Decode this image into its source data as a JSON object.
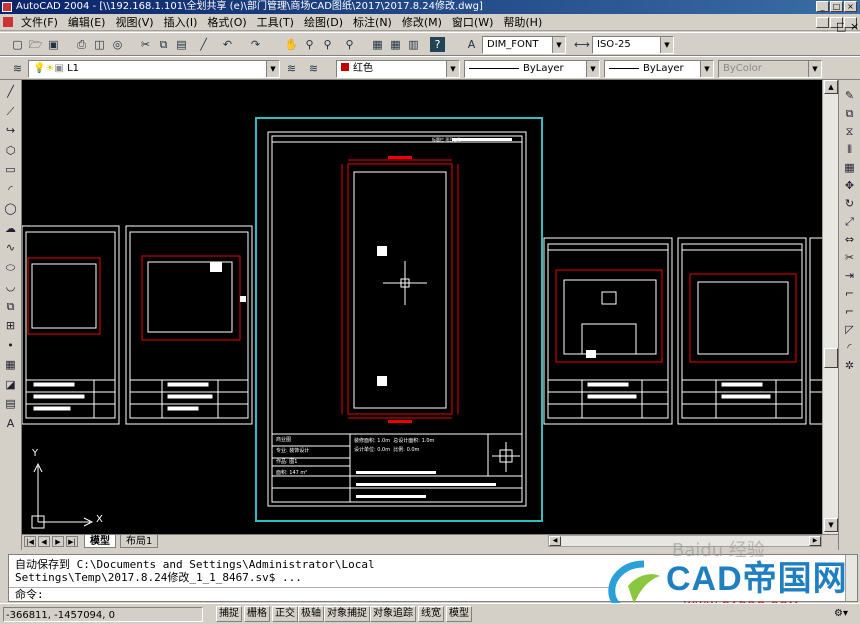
{
  "titlebar": {
    "title": "AutoCAD 2004 - [\\\\192.168.1.101\\全划共享 (e)\\部门管理\\商场CAD图纸\\2017\\2017.8.24修改.dwg]",
    "controls": [
      "_",
      "□",
      "×"
    ]
  },
  "doc_controls": [
    "_",
    "□",
    "×"
  ],
  "menu": [
    "文件(F)",
    "编辑(E)",
    "视图(V)",
    "插入(I)",
    "格式(O)",
    "工具(T)",
    "绘图(D)",
    "标注(N)",
    "修改(M)",
    "窗口(W)",
    "帮助(H)"
  ],
  "standard_toolbar": {
    "icons": [
      "new-icon",
      "open-icon",
      "save-icon",
      "print-icon",
      "preview-icon",
      "publish-icon",
      "cut-icon",
      "copy-icon",
      "paste-icon",
      "matchprop-icon",
      "undo-icon",
      "redo-icon",
      "pan-icon",
      "zoom-realtime-icon",
      "zoom-window-icon",
      "zoom-previous-icon",
      "properties-icon",
      "designcenter-icon",
      "toolpalette-icon",
      "help-icon"
    ],
    "text_style": "DIM_FONT",
    "dim_style": "ISO-25"
  },
  "layers_toolbar": {
    "layer_name": "L1",
    "color": "红色",
    "color_hex": "#c00000",
    "linetype": "ByLayer",
    "lineweight": "ByLayer",
    "plotstyle": "ByColor"
  },
  "left_tools": [
    "line-icon",
    "construction-line-icon",
    "polyline-icon",
    "polygon-icon",
    "rectangle-icon",
    "arc-icon",
    "circle-icon",
    "revcloud-icon",
    "spline-icon",
    "ellipse-icon",
    "ellipse-arc-icon",
    "insert-block-icon",
    "make-block-icon",
    "point-icon",
    "hatch-icon",
    "region-icon",
    "table-icon",
    "mtext-icon"
  ],
  "left_tools_glyphs": [
    "╱",
    "⟋",
    "↪",
    "⬡",
    "▭",
    "◜",
    "◯",
    "☁",
    "∿",
    "⬭",
    "◡",
    "⧉",
    "⊞",
    "•",
    "▦",
    "◪",
    "▤",
    "A"
  ],
  "right_tools": [
    "erase-icon",
    "copy-object-icon",
    "mirror-icon",
    "offset-icon",
    "array-icon",
    "move-icon",
    "rotate-icon",
    "scale-icon",
    "stretch-icon",
    "trim-icon",
    "extend-icon",
    "break-at-point-icon",
    "break-icon",
    "chamfer-icon",
    "fillet-icon",
    "explode-icon"
  ],
  "right_tools_glyphs": [
    "✎",
    "⧉",
    "⧖",
    "⫴",
    "▦",
    "✥",
    "↻",
    "⤢",
    "⇔",
    "✂",
    "⇥",
    "⌐",
    "⌐",
    "◸",
    "◜",
    "✲"
  ],
  "drawing": {
    "main_sheet_block": [
      "标题栏",
      "项目名称"
    ],
    "main_sheet_labels": [
      "商业图",
      "专业: 装饰设计",
      "作品: 图1",
      "面积: 147 m²"
    ],
    "main_sheet_info": [
      "装修面积: 1.0m",
      "总设计面积: 1.0m",
      "设计单位: 0.0m",
      "比例: 0.0m"
    ],
    "ucs_x": "X",
    "ucs_y": "Y"
  },
  "tabs": {
    "model": "模型",
    "layout1": "布局1"
  },
  "command": {
    "line1": "自动保存到 C:\\Documents and Settings\\Administrator\\Local",
    "line2": "Settings\\Temp\\2017.8.24修改_1_1_8467.sv$ ...",
    "prompt": "命令:"
  },
  "status": {
    "coords": "-366811, -1457094, 0",
    "toggles": [
      "捕捉",
      "栅格",
      "正交",
      "极轴",
      "对象捕捉",
      "对象追踪",
      "线宽",
      "模型"
    ]
  },
  "watermark": {
    "brand": "CAD帝国网",
    "url": "WWW.CADDG.COM",
    "overlay": "Baidu 经验"
  }
}
